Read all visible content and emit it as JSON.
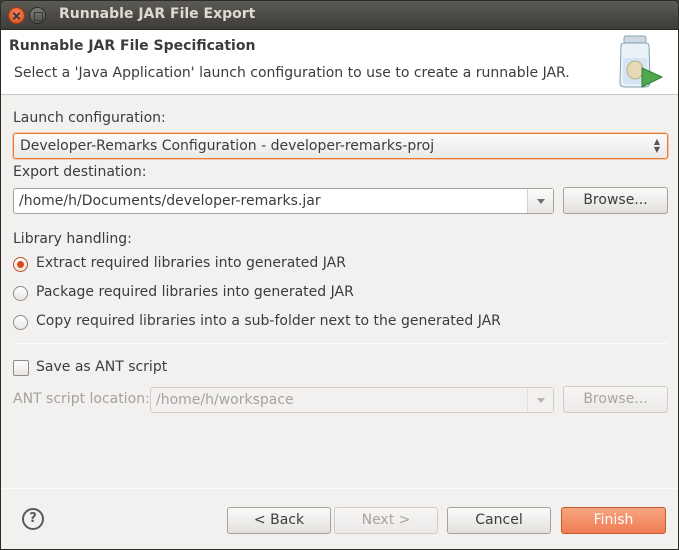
{
  "window": {
    "title": "Runnable JAR File Export"
  },
  "header": {
    "title": "Runnable JAR File Specification",
    "description": "Select a 'Java Application' launch configuration to use to create a runnable JAR."
  },
  "launch": {
    "label": "Launch configuration:",
    "selected": "Developer-Remarks Configuration - developer-remarks-proj"
  },
  "export": {
    "label": "Export destination:",
    "value": "/home/h/Documents/developer-remarks.jar",
    "browse": "Browse..."
  },
  "library": {
    "label": "Library handling:",
    "options": [
      {
        "label": "Extract required libraries into generated JAR",
        "checked": true
      },
      {
        "label": "Package required libraries into generated JAR",
        "checked": false
      },
      {
        "label": "Copy required libraries into a sub-folder next to the generated JAR",
        "checked": false
      }
    ]
  },
  "ant": {
    "checkbox_label": "Save as ANT script",
    "checked": false,
    "location_label": "ANT script location:",
    "location_value": "/home/h/workspace",
    "browse": "Browse..."
  },
  "footer": {
    "help": "?",
    "back": "< Back",
    "next": "Next >",
    "cancel": "Cancel",
    "finish": "Finish"
  },
  "colors": {
    "accent": "#dd4814",
    "finish": "#f07c53",
    "titlebar": "#3c3b37"
  }
}
